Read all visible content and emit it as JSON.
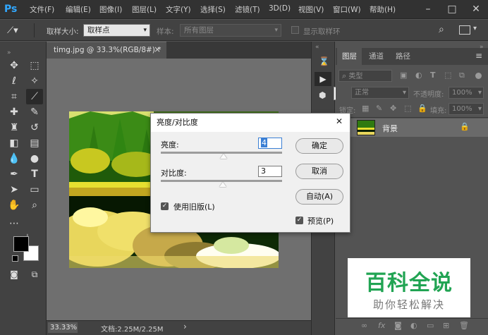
{
  "app": {
    "logo": "Ps"
  },
  "menu": [
    "文件(F)",
    "编辑(E)",
    "图像(I)",
    "图层(L)",
    "文字(Y)",
    "选择(S)",
    "滤镜(T)",
    "3D(D)",
    "视图(V)",
    "窗口(W)",
    "帮助(H)"
  ],
  "window_controls": {
    "minimize": "–",
    "maximize": "□",
    "close": "✕"
  },
  "options_bar": {
    "tool_icon": "eyedropper-icon",
    "sample_size_label": "取样大小:",
    "sample_size_value": "取样点",
    "sample_label": "样本:",
    "sample_value": "所有图层",
    "show_ring_label": "显示取样环"
  },
  "document": {
    "tab_title": "timg.jpg @ 33.3%(RGB/8#) *",
    "tab_close": "×",
    "zoom": "33.33%",
    "doc_info": "文档:2.25M/2.25M",
    "status_arrow": "›"
  },
  "dialog": {
    "title": "亮度/对比度",
    "close": "✕",
    "brightness_label": "亮度:",
    "brightness_value": "4",
    "contrast_label": "对比度:",
    "contrast_value": "3",
    "use_legacy_label": "使用旧版(L)",
    "use_legacy_checked": true,
    "ok_label": "确定",
    "cancel_label": "取消",
    "auto_label": "自动(A)",
    "preview_label": "预览(P)",
    "preview_checked": true
  },
  "actions_panel": {
    "tooltip": "动作"
  },
  "layers_panel": {
    "tabs": [
      "图层",
      "通道",
      "路径"
    ],
    "active_tab": "图层",
    "filter_label": "类型",
    "blend_mode": "正常",
    "opacity_label": "不透明度:",
    "opacity_value": "100%",
    "lock_label": "锁定:",
    "fill_label": "填充:",
    "fill_value": "100%",
    "layers": [
      {
        "name": "背景",
        "locked": true
      }
    ],
    "footer_icons": [
      "link-icon",
      "fx-icon",
      "mask-icon",
      "adjustment-icon",
      "folder-icon",
      "new-layer-icon",
      "trash-icon"
    ]
  },
  "watermark": {
    "main": "百科全说",
    "sub": "助你轻松解决"
  },
  "colors": {
    "accent": "#31a8ff",
    "watermark_green": "#21a453",
    "dialog_bg": "#f0f0f0"
  }
}
